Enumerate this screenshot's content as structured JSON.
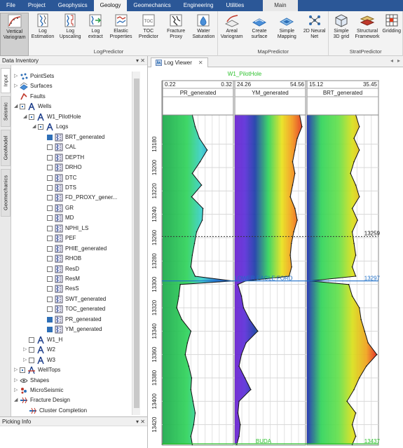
{
  "menubar": {
    "tabs": [
      "File",
      "Project",
      "Geophysics",
      "Geology",
      "Geomechanics",
      "Engineering",
      "Utilities",
      "Main"
    ],
    "active": "Geology"
  },
  "ribbon": {
    "groups": [
      {
        "label": "LogPredictor",
        "buttons": [
          {
            "label": "Vertical Variogram",
            "icon": "variogram-icon"
          },
          {
            "label": "Log Estimation",
            "icon": "log-estimation-icon"
          },
          {
            "label": "Log Upscaling",
            "icon": "log-upscaling-icon"
          },
          {
            "label": "Log extract",
            "icon": "log-extract-icon"
          },
          {
            "label": "Elastic Properties",
            "icon": "elastic-properties-icon"
          },
          {
            "label": "TOC Predictor",
            "icon": "toc-predictor-icon"
          },
          {
            "label": "Fracture Proxy",
            "icon": "fracture-proxy-icon"
          },
          {
            "label": "Water Saturation",
            "icon": "water-saturation-icon"
          }
        ]
      },
      {
        "label": "MapPredictor",
        "buttons": [
          {
            "label": "Areal Variogram",
            "icon": "areal-variogram-icon"
          },
          {
            "label": "Create surface",
            "icon": "create-surface-icon"
          },
          {
            "label": "Simple Mapping",
            "icon": "simple-mapping-icon"
          },
          {
            "label": "2D Neural Net",
            "icon": "neural-net-icon"
          }
        ]
      },
      {
        "label": "StratPredictor",
        "buttons": [
          {
            "label": "Simple 3D grid",
            "icon": "grid-3d-icon"
          },
          {
            "label": "Structural Framework",
            "icon": "structural-framework-icon"
          },
          {
            "label": "Gridding",
            "icon": "gridding-icon"
          }
        ]
      }
    ]
  },
  "left_panel": {
    "title": "Data Inventory",
    "tools": "▾ ✕",
    "side_tabs": [
      "Input",
      "Seismic",
      "GeoModel",
      "Geomechanics"
    ]
  },
  "tree": [
    {
      "label": "PointSets",
      "level": 0,
      "expander": "▷",
      "checkbox": "none",
      "icon": "pointsets-icon"
    },
    {
      "label": "Surfaces",
      "level": 0,
      "expander": "▷",
      "checkbox": "none",
      "icon": "surfaces-icon"
    },
    {
      "label": "Faults",
      "level": 0,
      "expander": "",
      "checkbox": "none",
      "icon": "faults-icon"
    },
    {
      "label": "Wells",
      "level": 0,
      "expander": "◢",
      "checkbox": "partial",
      "icon": "well-icon"
    },
    {
      "label": "W1_PilotHole",
      "level": 1,
      "expander": "◢",
      "checkbox": "partial",
      "icon": "well-icon"
    },
    {
      "label": "Logs",
      "level": 2,
      "expander": "◢",
      "checkbox": "partial",
      "icon": "well-icon"
    },
    {
      "label": "BRT_generated",
      "level": 3,
      "expander": "",
      "checkbox": "on",
      "icon": "log-icon"
    },
    {
      "label": "CAL",
      "level": 3,
      "expander": "",
      "checkbox": "off",
      "icon": "log-icon"
    },
    {
      "label": "DEPTH",
      "level": 3,
      "expander": "",
      "checkbox": "off",
      "icon": "log-icon"
    },
    {
      "label": "DRHO",
      "level": 3,
      "expander": "",
      "checkbox": "off",
      "icon": "log-icon"
    },
    {
      "label": "DTC",
      "level": 3,
      "expander": "",
      "checkbox": "off",
      "icon": "log-icon"
    },
    {
      "label": "DTS",
      "level": 3,
      "expander": "",
      "checkbox": "off",
      "icon": "log-icon"
    },
    {
      "label": "FD_PROXY_gener...",
      "level": 3,
      "expander": "",
      "checkbox": "off",
      "icon": "log-icon"
    },
    {
      "label": "GR",
      "level": 3,
      "expander": "",
      "checkbox": "off",
      "icon": "log-icon"
    },
    {
      "label": "MD",
      "level": 3,
      "expander": "",
      "checkbox": "off",
      "icon": "log-icon"
    },
    {
      "label": "NPHI_LS",
      "level": 3,
      "expander": "",
      "checkbox": "off",
      "icon": "log-icon"
    },
    {
      "label": "PEF",
      "level": 3,
      "expander": "",
      "checkbox": "off",
      "icon": "log-icon"
    },
    {
      "label": "PHIE_generated",
      "level": 3,
      "expander": "",
      "checkbox": "off",
      "icon": "log-icon"
    },
    {
      "label": "RHOB",
      "level": 3,
      "expander": "",
      "checkbox": "off",
      "icon": "log-icon"
    },
    {
      "label": "ResD",
      "level": 3,
      "expander": "",
      "checkbox": "off",
      "icon": "log-icon"
    },
    {
      "label": "ResM",
      "level": 3,
      "expander": "",
      "checkbox": "off",
      "icon": "log-icon"
    },
    {
      "label": "ResS",
      "level": 3,
      "expander": "",
      "checkbox": "off",
      "icon": "log-icon"
    },
    {
      "label": "SWT_generated",
      "level": 3,
      "expander": "",
      "checkbox": "off",
      "icon": "log-icon"
    },
    {
      "label": "TOC_generated",
      "level": 3,
      "expander": "",
      "checkbox": "off",
      "icon": "log-icon"
    },
    {
      "label": "PR_generated",
      "level": 3,
      "expander": "",
      "checkbox": "on",
      "icon": "log-icon"
    },
    {
      "label": "YM_generated",
      "level": 3,
      "expander": "",
      "checkbox": "on",
      "icon": "log-icon"
    },
    {
      "label": "W1_H",
      "level": 1,
      "expander": "",
      "checkbox": "off",
      "icon": "well-icon"
    },
    {
      "label": "W2",
      "level": 1,
      "expander": "▷",
      "checkbox": "off",
      "icon": "well-icon"
    },
    {
      "label": "W3",
      "level": 1,
      "expander": "▷",
      "checkbox": "off",
      "icon": "well-icon"
    },
    {
      "label": "WellTops",
      "level": 0,
      "expander": "▷",
      "checkbox": "partial",
      "icon": "welltops-icon"
    },
    {
      "label": "Shapes",
      "level": 0,
      "expander": "▷",
      "checkbox": "none",
      "icon": "shapes-icon"
    },
    {
      "label": "MicroSeismic",
      "level": 0,
      "expander": "▷",
      "checkbox": "none",
      "icon": "microseismic-icon"
    },
    {
      "label": "Fracture Design",
      "level": 0,
      "expander": "◢",
      "checkbox": "none",
      "icon": "fracture-design-icon"
    },
    {
      "label": "Cluster Completion",
      "level": 1,
      "expander": "",
      "checkbox": "none",
      "icon": "fracture-design-icon"
    }
  ],
  "picking": {
    "title": "Picking Info",
    "tools": "▾ ✕"
  },
  "viewer": {
    "tab_label": "Log Viewer",
    "tab_close": "✕",
    "nav_left": "◂",
    "nav_right": "▸",
    "well_name": "W1_PilotHole"
  },
  "chart_data": {
    "type": "line",
    "well": "W1_PilotHole",
    "depth_range": [
      13155,
      13437
    ],
    "depth_ticks": [
      13180,
      13200,
      13220,
      13240,
      13260,
      13280,
      13300,
      13320,
      13340,
      13360,
      13380,
      13400,
      13420
    ],
    "depth_marker": 13259,
    "tops": [
      {
        "name": "LOWER EAGLE FORD",
        "depth": 13297,
        "color": "#1e6fc8"
      },
      {
        "name": "BUDA",
        "depth": 13437,
        "color": "#2ec22e"
      }
    ],
    "tracks": [
      {
        "name": "PR_generated",
        "min": 0.22,
        "max": 0.32,
        "depths": [
          13155,
          13165,
          13175,
          13185,
          13195,
          13205,
          13215,
          13225,
          13235,
          13245,
          13255,
          13265,
          13275,
          13285,
          13293,
          13297,
          13300,
          13310,
          13320,
          13330,
          13340,
          13350,
          13360,
          13370,
          13380,
          13390,
          13400,
          13410,
          13420,
          13430,
          13437
        ],
        "values": [
          0.262,
          0.266,
          0.272,
          0.283,
          0.273,
          0.262,
          0.275,
          0.261,
          0.277,
          0.276,
          0.268,
          0.265,
          0.262,
          0.26,
          0.266,
          0.319,
          0.245,
          0.243,
          0.24,
          0.247,
          0.26,
          0.255,
          0.252,
          0.257,
          0.261,
          0.26,
          0.263,
          0.266,
          0.264,
          0.26,
          0.262
        ]
      },
      {
        "name": "YM_generated",
        "min": 24.26,
        "max": 54.56,
        "depths": [
          13155,
          13165,
          13175,
          13185,
          13195,
          13205,
          13215,
          13225,
          13235,
          13245,
          13255,
          13265,
          13275,
          13285,
          13293,
          13297,
          13300,
          13310,
          13320,
          13330,
          13340,
          13350,
          13360,
          13370,
          13380,
          13390,
          13400,
          13410,
          13420,
          13430,
          13437
        ],
        "values": [
          52,
          53,
          51,
          50,
          49,
          50,
          49,
          48,
          50,
          51,
          49.5,
          48.5,
          48,
          48.6,
          47.5,
          29,
          25.6,
          27.1,
          28,
          30.6,
          34.1,
          29.1,
          27.1,
          26.1,
          28.6,
          31.1,
          26.1,
          25.6,
          26.6,
          26.1,
          25.1
        ]
      },
      {
        "name": "BRT_generated",
        "min": 15.12,
        "max": 35.45,
        "depths": [
          13155,
          13165,
          13175,
          13185,
          13195,
          13205,
          13215,
          13225,
          13235,
          13245,
          13255,
          13265,
          13275,
          13285,
          13293,
          13297,
          13300,
          13310,
          13320,
          13330,
          13340,
          13350,
          13360,
          13370,
          13380,
          13390,
          13400,
          13410,
          13420,
          13430,
          13437
        ],
        "values": [
          29,
          30,
          28.5,
          30,
          28.5,
          27.5,
          29,
          30,
          28,
          29.5,
          28,
          28.5,
          29,
          28,
          29,
          16,
          27,
          28,
          30,
          30.5,
          31.5,
          32.5,
          35,
          32,
          30,
          28.5,
          26.5,
          29,
          28,
          29,
          28
        ]
      }
    ]
  }
}
